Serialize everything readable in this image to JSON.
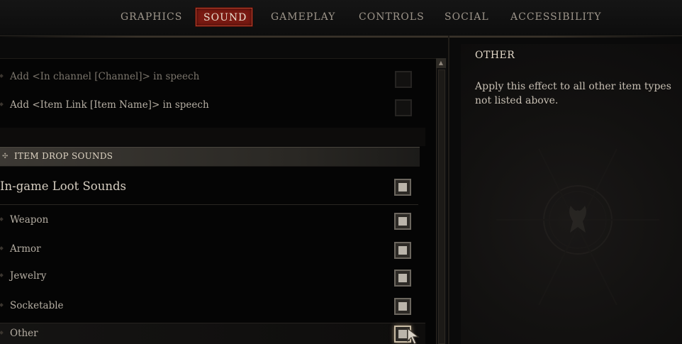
{
  "tabs": [
    {
      "label": "GRAPHICS",
      "active": false
    },
    {
      "label": "SOUND",
      "active": true
    },
    {
      "label": "GAMEPLAY",
      "active": false
    },
    {
      "label": "CONTROLS",
      "active": false
    },
    {
      "label": "SOCIAL",
      "active": false
    },
    {
      "label": "ACCESSIBILITY",
      "active": false
    }
  ],
  "speech_options": [
    {
      "label": "Add <In channel [Channel]> in speech",
      "enabled": false
    },
    {
      "label": "Add <Item Link [Item Name]> in speech",
      "enabled": false
    }
  ],
  "item_drop": {
    "section_title": "ITEM DROP SOUNDS",
    "master_label": "In-game Loot Sounds",
    "items": [
      {
        "label": "Weapon",
        "checked": true
      },
      {
        "label": "Armor",
        "checked": true
      },
      {
        "label": "Jewelry",
        "checked": true
      },
      {
        "label": "Socketable",
        "checked": true
      },
      {
        "label": "Other",
        "checked": true,
        "selected": true
      }
    ]
  },
  "info": {
    "title": "OTHER",
    "description": "Apply this effect to all other item types not listed above."
  },
  "colors": {
    "active_tab": "#7a1a12",
    "text": "#b5aea3",
    "accent_border": "#b8432e"
  },
  "icons": {
    "section": "diamond-cluster-icon",
    "scroll_up": "triangle-up-icon",
    "cursor": "pointer-cursor-icon"
  }
}
